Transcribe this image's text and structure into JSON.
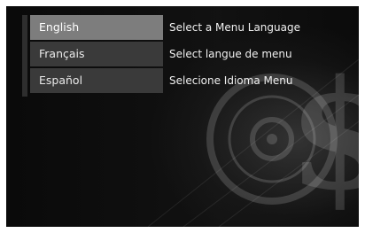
{
  "language_menu": {
    "options": [
      {
        "label": "English",
        "prompt": "Select a Menu Language",
        "selected": true
      },
      {
        "label": "Français",
        "prompt": "Select langue de menu",
        "selected": false
      },
      {
        "label": "Español",
        "prompt": "Selecione Idioma Menu",
        "selected": false
      }
    ]
  },
  "colors": {
    "background": "#0a0a0a",
    "item_normal": "#3a3a3a",
    "item_selected": "#7d7d7d",
    "text": "#eaeaea"
  },
  "background_art": {
    "icons": [
      "disc-icon",
      "dollar-sign-icon"
    ]
  }
}
